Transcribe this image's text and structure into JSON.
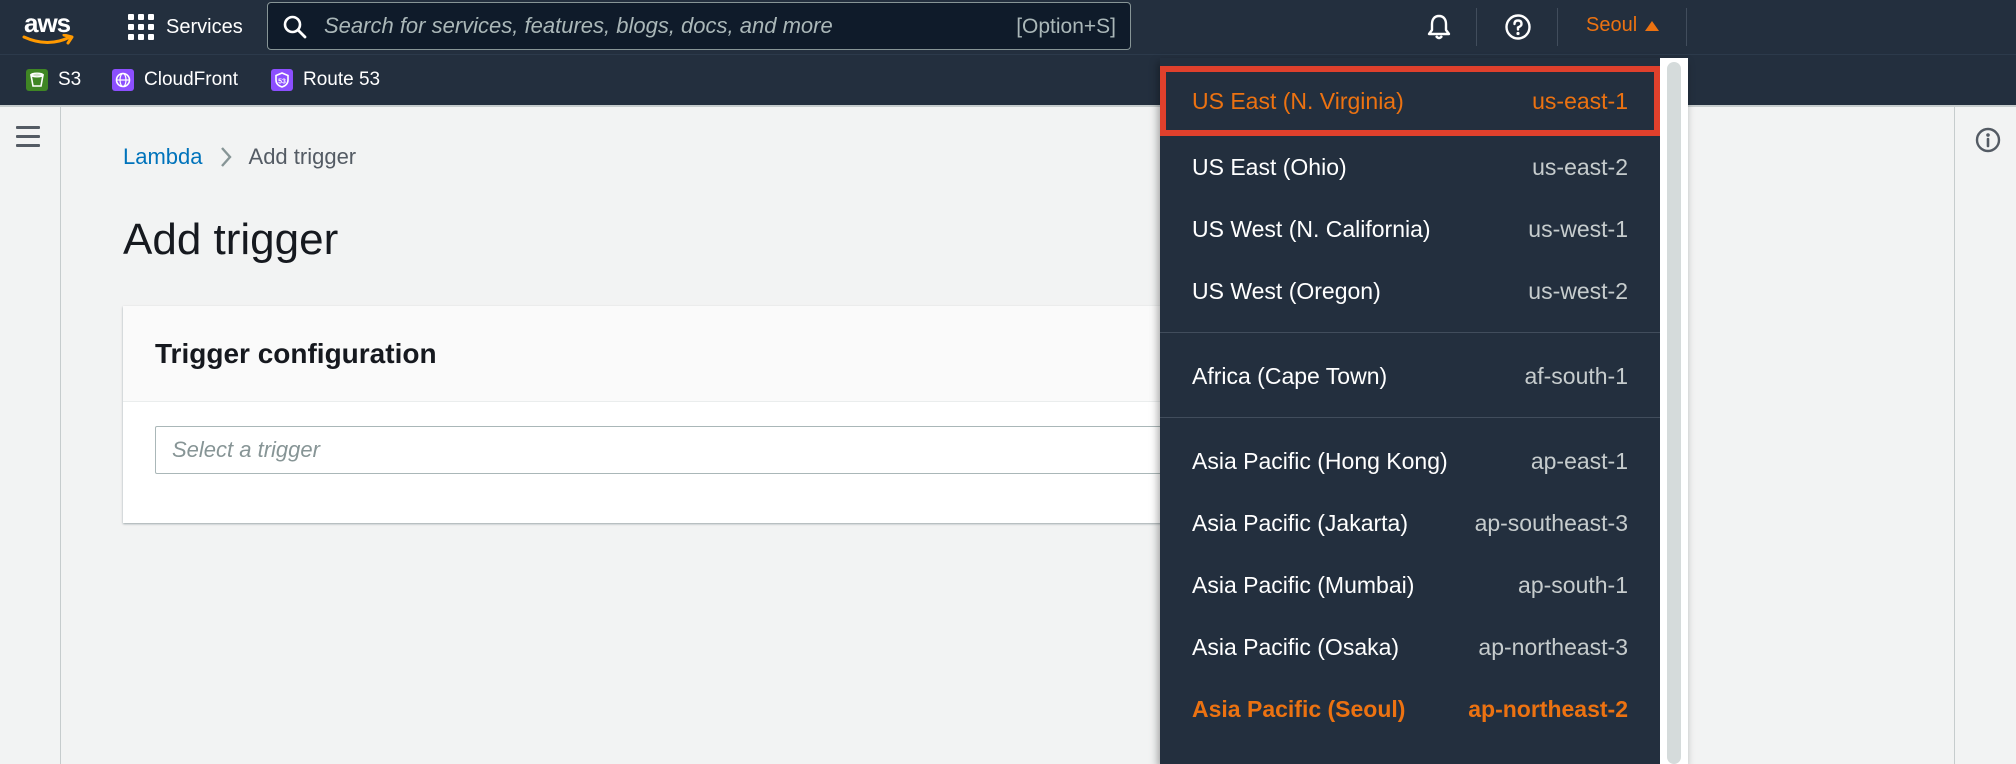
{
  "nav": {
    "logo_text": "aws",
    "services_label": "Services",
    "search_placeholder": "Search for services, features, blogs, docs, and more",
    "search_shortcut": "[Option+S]",
    "region_label": "Seoul"
  },
  "favorites": [
    {
      "label": "S3",
      "color": "#3f8624"
    },
    {
      "label": "CloudFront",
      "color": "#8c4fff"
    },
    {
      "label": "Route 53",
      "color": "#8c4fff"
    }
  ],
  "breadcrumb": {
    "root": "Lambda",
    "current": "Add trigger"
  },
  "page": {
    "title": "Add trigger"
  },
  "panel": {
    "heading": "Trigger configuration",
    "select_placeholder": "Select a trigger"
  },
  "region_menu": {
    "groups": [
      [
        {
          "name": "US East (N. Virginia)",
          "code": "us-east-1",
          "state": "highlight"
        },
        {
          "name": "US East (Ohio)",
          "code": "us-east-2",
          "state": ""
        },
        {
          "name": "US West (N. California)",
          "code": "us-west-1",
          "state": ""
        },
        {
          "name": "US West (Oregon)",
          "code": "us-west-2",
          "state": ""
        }
      ],
      [
        {
          "name": "Africa (Cape Town)",
          "code": "af-south-1",
          "state": ""
        }
      ],
      [
        {
          "name": "Asia Pacific (Hong Kong)",
          "code": "ap-east-1",
          "state": ""
        },
        {
          "name": "Asia Pacific (Jakarta)",
          "code": "ap-southeast-3",
          "state": ""
        },
        {
          "name": "Asia Pacific (Mumbai)",
          "code": "ap-south-1",
          "state": ""
        },
        {
          "name": "Asia Pacific (Osaka)",
          "code": "ap-northeast-3",
          "state": ""
        },
        {
          "name": "Asia Pacific (Seoul)",
          "code": "ap-northeast-2",
          "state": "selected"
        }
      ]
    ]
  },
  "colors": {
    "nav_bg": "#232f3e",
    "accent": "#ec7211",
    "highlight_border": "#e0402c",
    "link": "#0073bb"
  }
}
